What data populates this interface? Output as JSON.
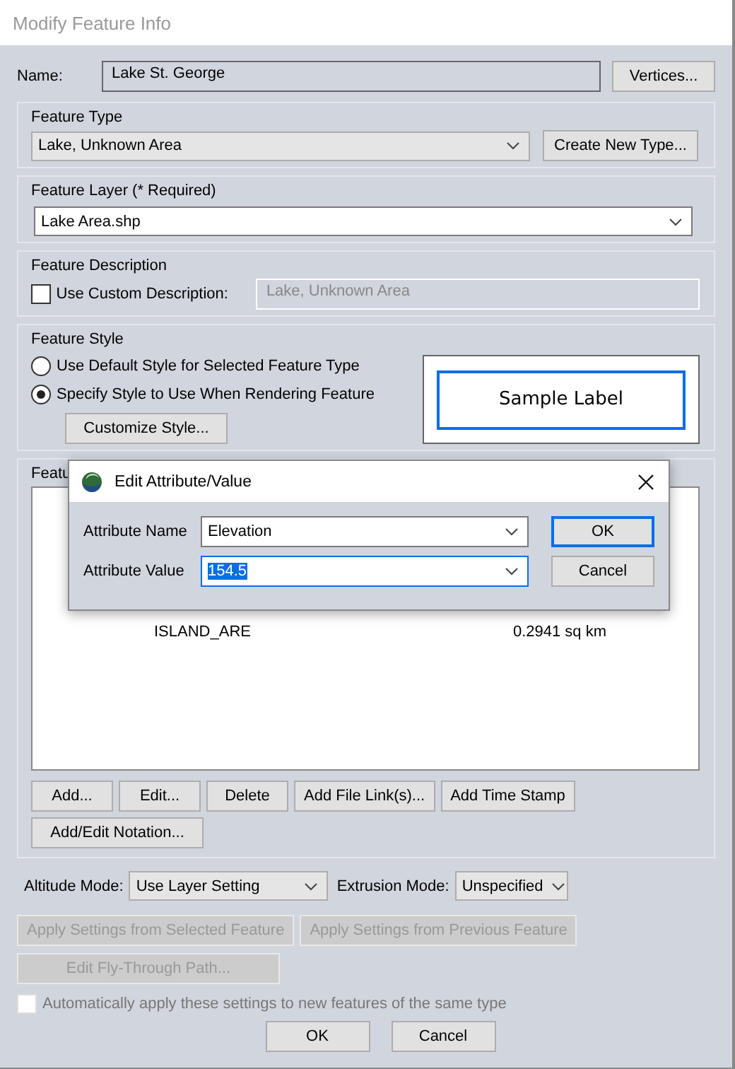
{
  "window": {
    "title": "Modify Feature Info"
  },
  "name": {
    "label": "Name:",
    "value": "Lake St. George",
    "button": "Vertices..."
  },
  "feature_type": {
    "title": "Feature Type",
    "value": "Lake, Unknown Area",
    "button": "Create New Type..."
  },
  "feature_layer": {
    "title": "Feature Layer (* Required)",
    "value": "Lake Area.shp"
  },
  "feature_description": {
    "title": "Feature Description",
    "checkbox": {
      "label": "Use Custom Description:",
      "checked": false
    },
    "value": "Lake, Unknown Area",
    "disabled": true
  },
  "feature_style": {
    "title": "Feature Style",
    "options": [
      {
        "label": "Use Default Style for Selected Feature Type",
        "selected": false
      },
      {
        "label": "Specify Style to Use When Rendering Feature",
        "selected": true
      }
    ],
    "button": "Customize Style...",
    "sample_label": "Sample Label"
  },
  "feature_attributes": {
    "title": "Featu",
    "rows": [
      {
        "name": "ISLAND_ARE",
        "value": "0.2941 sq km"
      }
    ],
    "buttons": [
      "Add...",
      "Edit...",
      "Delete",
      "Add File Link(s)...",
      "Add Time Stamp"
    ],
    "notation_button": "Add/Edit Notation..."
  },
  "altitude_mode": {
    "label": "Altitude Mode:",
    "value": "Use Layer Setting"
  },
  "extrusion_mode": {
    "label": "Extrusion Mode:",
    "value": "Unspecified"
  },
  "apply_buttons": [
    {
      "label": "Apply Settings from Selected Feature",
      "disabled": true
    },
    {
      "label": "Apply Settings from Previous Feature",
      "disabled": true
    }
  ],
  "fly_through_button": {
    "label": "Edit Fly-Through Path...",
    "disabled": true
  },
  "auto_apply": {
    "label": "Automatically apply these settings to new features of the same type",
    "checked": false,
    "disabled": true
  },
  "footer_buttons": [
    "OK",
    "Cancel"
  ],
  "edit_dialog": {
    "title": "Edit Attribute/Value",
    "fields": [
      {
        "label": "Attribute Name",
        "value": "Elevation",
        "focused": false
      },
      {
        "label": "Attribute Value",
        "value": "154.5",
        "focused": true
      }
    ],
    "buttons": [
      {
        "label": "OK",
        "default": true
      },
      {
        "label": "Cancel",
        "default": false
      }
    ]
  }
}
